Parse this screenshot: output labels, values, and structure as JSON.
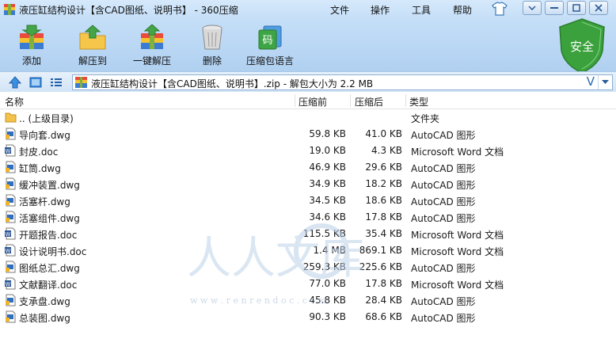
{
  "window": {
    "title": "液压缸结构设计【含CAD图纸、说明书】 - 360压缩"
  },
  "menu": [
    "文件",
    "操作",
    "工具",
    "帮助"
  ],
  "toolbar": {
    "add_label": "添加",
    "extract_to_label": "解压到",
    "one_click_label": "一键解压",
    "delete_label": "删除",
    "language_label": "压缩包语言",
    "language_icon_text": "码"
  },
  "badge": {
    "safe_label": "安全",
    "color": "#3aa13c"
  },
  "address": {
    "path": "液压缸结构设计【含CAD图纸、说明书】.zip - 解包大小为 2.2 MB",
    "verified_glyph": "V"
  },
  "columns": {
    "name": "名称",
    "size": "压缩前",
    "packed": "压缩后",
    "type": "类型"
  },
  "rows": [
    {
      "name": ".. (上级目录)",
      "size": "",
      "packed": "",
      "type": "文件夹",
      "icon": "folder-icon"
    },
    {
      "name": "导向套.dwg",
      "size": "59.8 KB",
      "packed": "41.0 KB",
      "type": "AutoCAD 图形",
      "icon": "dwg-icon"
    },
    {
      "name": "封皮.doc",
      "size": "19.0 KB",
      "packed": "4.3 KB",
      "type": "Microsoft Word 文档",
      "icon": "doc-icon"
    },
    {
      "name": "缸筒.dwg",
      "size": "46.9 KB",
      "packed": "29.6 KB",
      "type": "AutoCAD 图形",
      "icon": "dwg-icon"
    },
    {
      "name": "缓冲装置.dwg",
      "size": "34.9 KB",
      "packed": "18.2 KB",
      "type": "AutoCAD 图形",
      "icon": "dwg-icon"
    },
    {
      "name": "活塞杆.dwg",
      "size": "34.5 KB",
      "packed": "18.6 KB",
      "type": "AutoCAD 图形",
      "icon": "dwg-icon"
    },
    {
      "name": "活塞组件.dwg",
      "size": "34.6 KB",
      "packed": "17.8 KB",
      "type": "AutoCAD 图形",
      "icon": "dwg-icon"
    },
    {
      "name": "开题报告.doc",
      "size": "115.5 KB",
      "packed": "35.4 KB",
      "type": "Microsoft Word 文档",
      "icon": "doc-icon"
    },
    {
      "name": "设计说明书.doc",
      "size": "1.4 MB",
      "packed": "869.1 KB",
      "type": "Microsoft Word 文档",
      "icon": "doc-icon"
    },
    {
      "name": "图纸总汇.dwg",
      "size": "259.3 KB",
      "packed": "225.6 KB",
      "type": "AutoCAD 图形",
      "icon": "dwg-icon"
    },
    {
      "name": "文献翻译.doc",
      "size": "77.0 KB",
      "packed": "17.8 KB",
      "type": "Microsoft Word 文档",
      "icon": "doc-icon"
    },
    {
      "name": "支承盘.dwg",
      "size": "45.8 KB",
      "packed": "28.4 KB",
      "type": "AutoCAD 图形",
      "icon": "dwg-icon"
    },
    {
      "name": "总装图.dwg",
      "size": "90.3 KB",
      "packed": "68.6 KB",
      "type": "AutoCAD 图形",
      "icon": "dwg-icon"
    }
  ],
  "watermark": {
    "chars": "人人文库",
    "url": "w w w . r e n r e n d o c . c o m"
  }
}
